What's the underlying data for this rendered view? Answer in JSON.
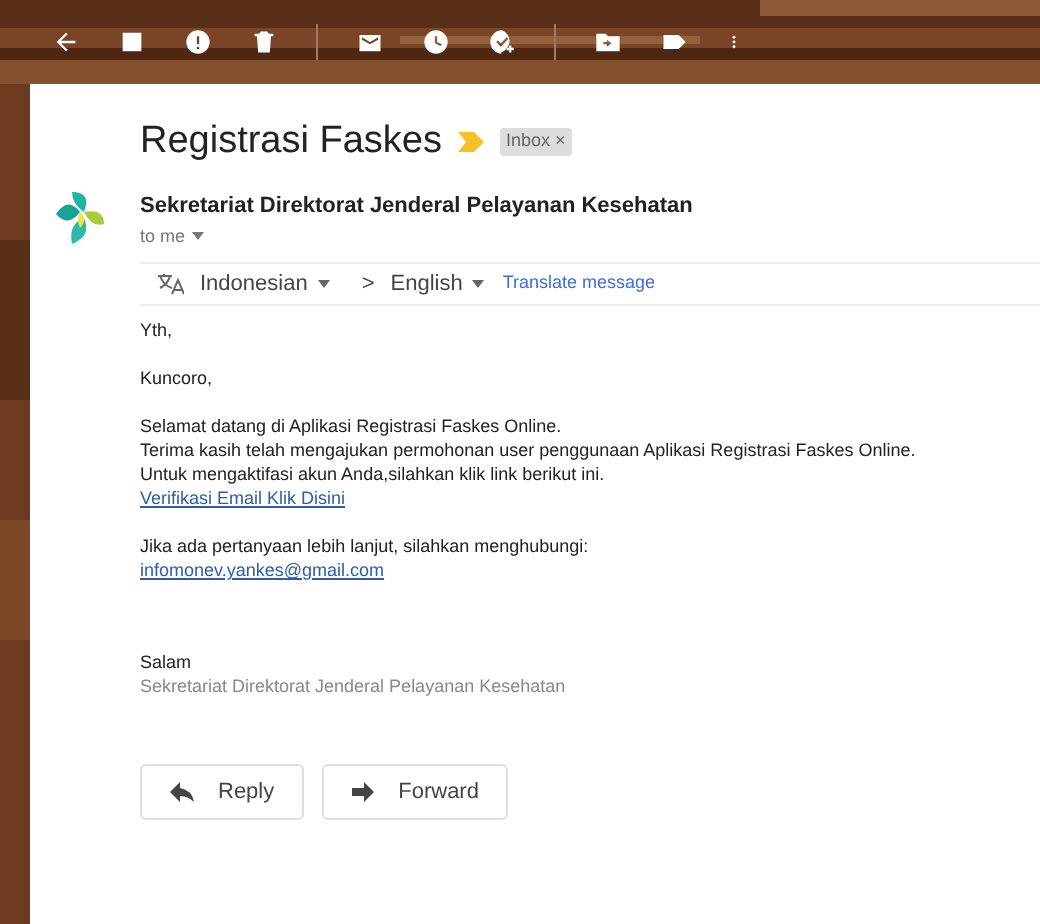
{
  "message": {
    "subject": "Registrasi Faskes",
    "important": true,
    "labels": [
      {
        "text": "Inbox",
        "remove": "×"
      }
    ],
    "sender": {
      "name": "Sekretariat Direktorat Jenderal Pelayanan Kesehatan",
      "recipient": "to me"
    },
    "translate": {
      "source": "Indonesian",
      "separator": ">",
      "target": "English",
      "action": "Translate message"
    },
    "body": [
      {
        "lines": [
          {
            "kind": "text",
            "text": "Yth,"
          }
        ]
      },
      {
        "lines": [
          {
            "kind": "text",
            "text": "Kuncoro,"
          }
        ]
      },
      {
        "lines": [
          {
            "kind": "text",
            "text": "Selamat datang di Aplikasi Registrasi Faskes Online."
          },
          {
            "kind": "text",
            "text": "Terima kasih telah mengajukan permohonan user penggunaan Aplikasi Registrasi Faskes Online."
          },
          {
            "kind": "text",
            "text": "Untuk mengaktifasi akun Anda,silahkan klik link berikut ini."
          },
          {
            "kind": "link",
            "text": "Verifikasi Email Klik Disini"
          }
        ]
      },
      {
        "lines": [
          {
            "kind": "text",
            "text": "Jika ada pertanyaan lebih lanjut, silahkan menghubungi:"
          },
          {
            "kind": "link",
            "text": "infomonev.yankes@gmail.com"
          }
        ]
      }
    ],
    "signature": {
      "greeting": "Salam",
      "name": "Sekretariat Direktorat Jenderal Pelayanan Kesehatan"
    },
    "actions": [
      {
        "kind": "reply",
        "label": "Reply"
      },
      {
        "kind": "forward",
        "label": "Forward"
      }
    ]
  }
}
